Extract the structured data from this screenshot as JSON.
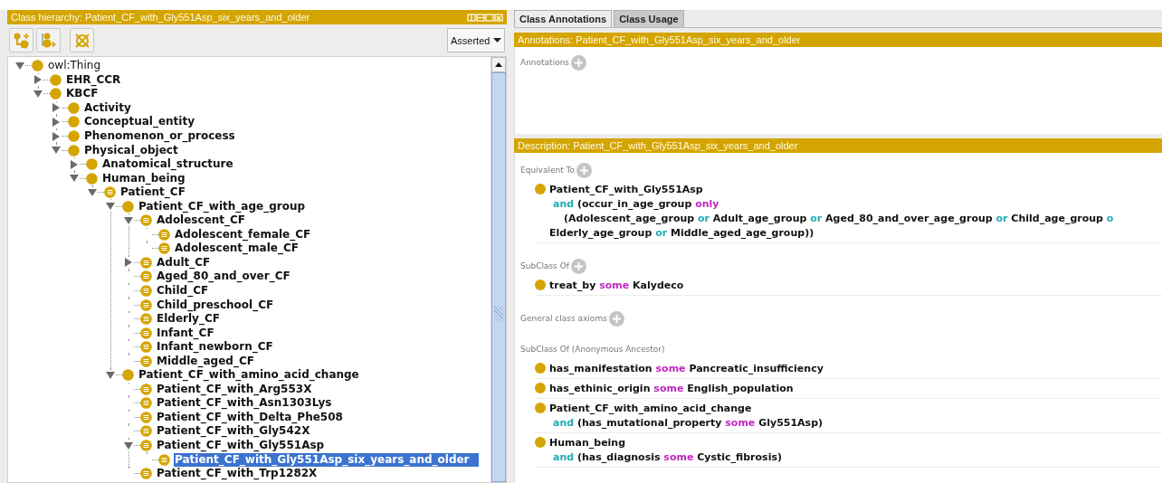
{
  "class_hierarchy": {
    "title": "Class hierarchy: Patient_CF_with_Gly551Asp_six_years_and_older",
    "view_selector": "Asserted",
    "tree": [
      {
        "label": "owl:Thing",
        "kind": "primitive",
        "expanded": true,
        "selected": false,
        "children": [
          {
            "label": "EHR_CCR",
            "kind": "primitive",
            "expanded": false,
            "selected": false
          },
          {
            "label": "KBCF",
            "kind": "primitive",
            "expanded": true,
            "selected": false,
            "children": [
              {
                "label": "Activity",
                "kind": "primitive",
                "expanded": false,
                "selected": false
              },
              {
                "label": "Conceptual_entity",
                "kind": "primitive",
                "expanded": false,
                "selected": false
              },
              {
                "label": "Phenomenon_or_process",
                "kind": "primitive",
                "expanded": false,
                "selected": false
              },
              {
                "label": "Physical_object",
                "kind": "primitive",
                "expanded": true,
                "selected": false,
                "children": [
                  {
                    "label": "Anatomical_structure",
                    "kind": "primitive",
                    "expanded": false,
                    "selected": false
                  },
                  {
                    "label": "Human_being",
                    "kind": "primitive",
                    "expanded": true,
                    "selected": false,
                    "children": [
                      {
                        "label": "Patient_CF",
                        "kind": "defined",
                        "expanded": true,
                        "selected": false,
                        "children": [
                          {
                            "label": "Patient_CF_with_age_group",
                            "kind": "primitive",
                            "expanded": true,
                            "selected": false,
                            "children": [
                              {
                                "label": "Adolescent_CF",
                                "kind": "defined",
                                "expanded": true,
                                "selected": false,
                                "children": [
                                  {
                                    "label": "Adolescent_female_CF",
                                    "kind": "defined",
                                    "selected": false
                                  },
                                  {
                                    "label": "Adolescent_male_CF",
                                    "kind": "defined",
                                    "selected": false
                                  }
                                ]
                              },
                              {
                                "label": "Adult_CF",
                                "kind": "defined",
                                "expanded": false,
                                "selected": false
                              },
                              {
                                "label": "Aged_80_and_over_CF",
                                "kind": "defined",
                                "selected": false
                              },
                              {
                                "label": "Child_CF",
                                "kind": "defined",
                                "selected": false
                              },
                              {
                                "label": "Child_preschool_CF",
                                "kind": "defined",
                                "selected": false
                              },
                              {
                                "label": "Elderly_CF",
                                "kind": "defined",
                                "selected": false
                              },
                              {
                                "label": "Infant_CF",
                                "kind": "defined",
                                "selected": false
                              },
                              {
                                "label": "Infant_newborn_CF",
                                "kind": "defined",
                                "selected": false
                              },
                              {
                                "label": "Middle_aged_CF",
                                "kind": "defined",
                                "selected": false
                              }
                            ]
                          },
                          {
                            "label": "Patient_CF_with_amino_acid_change",
                            "kind": "primitive",
                            "expanded": true,
                            "selected": false,
                            "children": [
                              {
                                "label": "Patient_CF_with_Arg553X",
                                "kind": "defined",
                                "selected": false
                              },
                              {
                                "label": "Patient_CF_with_Asn1303Lys",
                                "kind": "defined",
                                "selected": false
                              },
                              {
                                "label": "Patient_CF_with_Delta_Phe508",
                                "kind": "defined",
                                "selected": false
                              },
                              {
                                "label": "Patient_CF_with_Gly542X",
                                "kind": "defined",
                                "selected": false
                              },
                              {
                                "label": "Patient_CF_with_Gly551Asp",
                                "kind": "defined",
                                "expanded": true,
                                "selected": false,
                                "children": [
                                  {
                                    "label": "Patient_CF_with_Gly551Asp_six_years_and_older",
                                    "kind": "defined",
                                    "selected": true
                                  }
                                ]
                              },
                              {
                                "label": "Patient_CF_with_Trp1282X",
                                "kind": "defined",
                                "selected": false
                              }
                            ]
                          }
                        ]
                      }
                    ]
                  }
                ]
              }
            ]
          }
        ]
      }
    ]
  },
  "class_panel": {
    "tabs": [
      {
        "label": "Class Annotations",
        "selected": true
      },
      {
        "label": "Class Usage",
        "selected": false
      }
    ],
    "annotations": {
      "title": "Annotations: Patient_CF_with_Gly551Asp_six_years_and_older",
      "sections": [
        {
          "label": "Annotations",
          "addable": true
        }
      ]
    },
    "description": {
      "title": "Description: Patient_CF_with_Gly551Asp_six_years_and_older",
      "sections": [
        {
          "label": "Equivalent To",
          "addable": true,
          "items": [
            {
              "lines": [
                {
                  "kind": "head",
                  "segments": [
                    {
                      "text": "Patient_CF_with_Gly551Asp",
                      "kind": "entity"
                    }
                  ]
                },
                {
                  "kind": "continuation",
                  "segments": [
                    {
                      "text": "and",
                      "kind": "connective"
                    },
                    {
                      "text": "(occur_in_age_group",
                      "kind": "entity"
                    },
                    {
                      "text": "only",
                      "kind": "quantifier"
                    }
                  ]
                },
                {
                  "kind": "nested",
                  "segments": [
                    {
                      "text": "(Adolescent_age_group",
                      "kind": "entity"
                    },
                    {
                      "text": "or",
                      "kind": "connective"
                    },
                    {
                      "text": "Adult_age_group",
                      "kind": "entity"
                    },
                    {
                      "text": "or",
                      "kind": "connective"
                    },
                    {
                      "text": "Aged_80_and_over_age_group",
                      "kind": "entity"
                    },
                    {
                      "text": "or",
                      "kind": "connective"
                    },
                    {
                      "text": "Child_age_group",
                      "kind": "entity"
                    },
                    {
                      "text": "o",
                      "kind": "connective"
                    }
                  ]
                },
                {
                  "kind": "wrap",
                  "segments": [
                    {
                      "text": "Elderly_age_group",
                      "kind": "entity"
                    },
                    {
                      "text": "or",
                      "kind": "connective"
                    },
                    {
                      "text": "Middle_aged_age_group))",
                      "kind": "entity"
                    }
                  ]
                }
              ]
            }
          ]
        },
        {
          "label": "SubClass Of",
          "addable": true,
          "items": [
            {
              "lines": [
                {
                  "kind": "head",
                  "segments": [
                    {
                      "text": "treat_by",
                      "kind": "entity"
                    },
                    {
                      "text": "some",
                      "kind": "quantifier"
                    },
                    {
                      "text": "Kalydeco",
                      "kind": "entity"
                    }
                  ]
                }
              ]
            }
          ]
        },
        {
          "label": "General class axioms",
          "addable": true
        },
        {
          "label": "SubClass Of (Anonymous Ancestor)",
          "addable": false,
          "items": [
            {
              "lines": [
                {
                  "kind": "head",
                  "segments": [
                    {
                      "text": "has_manifestation",
                      "kind": "entity"
                    },
                    {
                      "text": "some",
                      "kind": "quantifier"
                    },
                    {
                      "text": "Pancreatic_insufficiency",
                      "kind": "entity"
                    }
                  ]
                }
              ]
            },
            {
              "lines": [
                {
                  "kind": "head",
                  "segments": [
                    {
                      "text": "has_ethinic_origin",
                      "kind": "entity"
                    },
                    {
                      "text": "some",
                      "kind": "quantifier"
                    },
                    {
                      "text": "English_population",
                      "kind": "entity"
                    }
                  ]
                }
              ]
            },
            {
              "lines": [
                {
                  "kind": "head",
                  "segments": [
                    {
                      "text": "Patient_CF_with_amino_acid_change",
                      "kind": "entity"
                    }
                  ]
                },
                {
                  "kind": "continuation",
                  "segments": [
                    {
                      "text": "and",
                      "kind": "connective"
                    },
                    {
                      "text": "(has_mutational_property",
                      "kind": "entity"
                    },
                    {
                      "text": "some",
                      "kind": "quantifier"
                    },
                    {
                      "text": "Gly551Asp)",
                      "kind": "entity"
                    }
                  ]
                }
              ]
            },
            {
              "lines": [
                {
                  "kind": "head",
                  "segments": [
                    {
                      "text": "Human_being",
                      "kind": "entity"
                    }
                  ]
                },
                {
                  "kind": "continuation",
                  "segments": [
                    {
                      "text": "and",
                      "kind": "connective"
                    },
                    {
                      "text": "(has_diagnosis",
                      "kind": "entity"
                    },
                    {
                      "text": "some",
                      "kind": "quantifier"
                    },
                    {
                      "text": "Cystic_fibrosis)",
                      "kind": "entity"
                    }
                  ]
                }
              ]
            }
          ]
        }
      ]
    }
  }
}
